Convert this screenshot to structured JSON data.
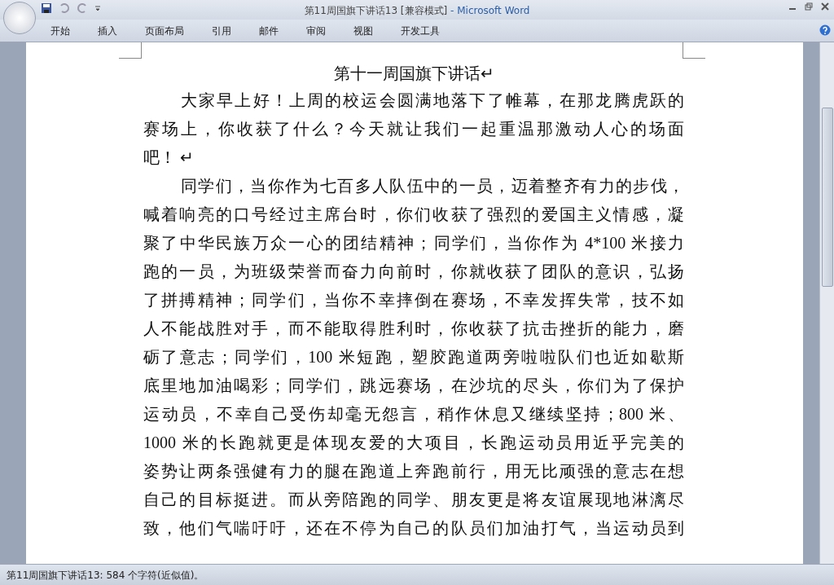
{
  "window": {
    "title": "第11周国旗下讲话13 [兼容模式]",
    "app": "- Microsoft Word"
  },
  "ribbon_tabs": [
    {
      "label": "开始",
      "selected": false
    },
    {
      "label": "插入",
      "selected": false
    },
    {
      "label": "页面布局",
      "selected": false
    },
    {
      "label": "引用",
      "selected": false
    },
    {
      "label": "邮件",
      "selected": false
    },
    {
      "label": "审阅",
      "selected": false
    },
    {
      "label": "视图",
      "selected": false
    },
    {
      "label": "开发工具",
      "selected": false
    }
  ],
  "document": {
    "title": "第十一周国旗下讲话↵",
    "paragraphs": [
      {
        "complete": true,
        "lines": [
          "大家早上好！上周的校运会圆满地落下了帷幕，在那龙腾虎跃的",
          "赛场上，你收获了什么？今天就让我们一起重温那激动人心的场面",
          "吧！ ↵"
        ]
      },
      {
        "complete": false,
        "lines": [
          "同学们，当你作为七百多人队伍中的一员，迈着整齐有力的步伐，",
          "喊着响亮的口号经过主席台时，你们收获了强烈的爱国主义情感，凝",
          "聚了中华民族万众一心的团结精神；同学们，当你作为 4*100 米接力",
          "跑的一员，为班级荣誉而奋力向前时，你就收获了团队的意识，弘扬",
          "了拼搏精神；同学们，当你不幸摔倒在赛场，不幸发挥失常，技不如",
          "人不能战胜对手，而不能取得胜利时，你收获了抗击挫折的能力，磨",
          "砺了意志；同学们，100 米短跑，塑胶跑道两旁啦啦队们也近如歇斯",
          "底里地加油喝彩；同学们，跳远赛场，在沙坑的尽头，你们为了保护",
          "运动员，不幸自己受伤却毫无怨言，稍作休息又继续坚持；800 米、",
          "1000  米的长跑就更是体现友爱的大项目，长跑运动员用近乎完美的",
          "姿势让两条强健有力的腿在跑道上奔跑前行，用无比顽强的意志在想",
          "自己的目标挺进。而从旁陪跑的同学、朋友更是将友谊展现地淋漓尽",
          "致，他们气喘吁吁，还在不停为自己的队员们加油打气，当运动员到"
        ]
      }
    ]
  },
  "status_bar": {
    "text": "第11周国旗下讲话13: 584 个字符(近似值)。"
  }
}
